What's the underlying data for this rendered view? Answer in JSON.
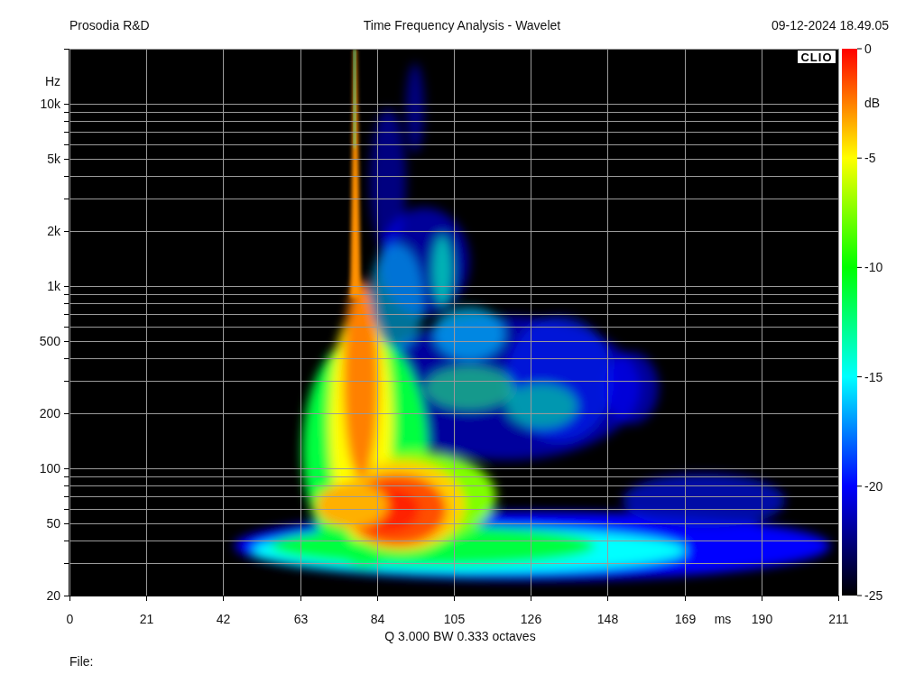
{
  "header": {
    "company": "Prosodia R&D",
    "title": "Time Frequency Analysis - Wavelet",
    "timestamp": "09-12-2024 18.49.05"
  },
  "plot": {
    "logo": "CLIO",
    "y_axis": {
      "unit": "Hz",
      "ticks": [
        "10k",
        "5k",
        "2k",
        "1k",
        "500",
        "200",
        "100",
        "50",
        "20"
      ]
    },
    "x_axis": {
      "unit": "ms",
      "ticks": [
        "0",
        "21",
        "42",
        "63",
        "84",
        "105",
        "126",
        "148",
        "169",
        "190",
        "211"
      ]
    },
    "colorbar": {
      "unit": "dB",
      "ticks": [
        "0",
        "-5",
        "-10",
        "-15",
        "-20",
        "-25"
      ]
    },
    "caption": "Q 3.000 BW 0.333 octaves"
  },
  "footer": {
    "file_label": "File:"
  }
}
